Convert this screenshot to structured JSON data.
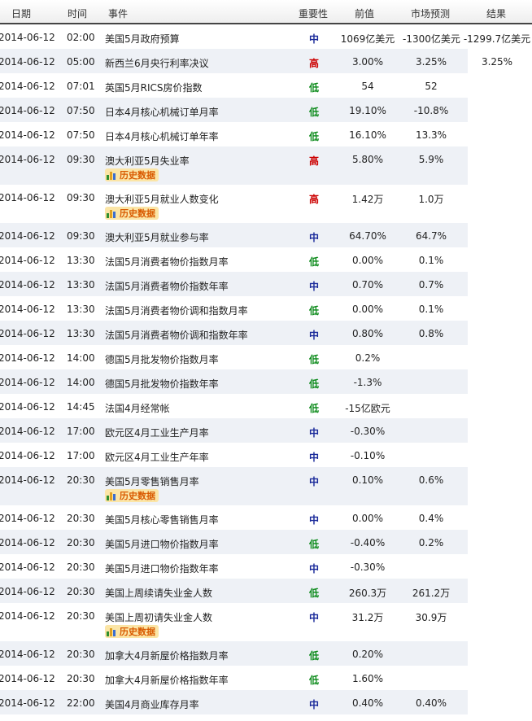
{
  "header": {
    "date": "日期",
    "time": "时间",
    "event": "事件",
    "importance": "重要性",
    "previous": "前值",
    "forecast": "市场预测",
    "result": "结果"
  },
  "history_label": "历史数据",
  "rows": [
    {
      "date": "2014-06-12",
      "time": "02:00",
      "event": "美国5月政府预算",
      "imp": "中",
      "prev": "1069亿美元",
      "fore": "-1300亿美元",
      "res": "-1299.7亿美元",
      "hist": false
    },
    {
      "date": "2014-06-12",
      "time": "05:00",
      "event": "新西兰6月央行利率决议",
      "imp": "高",
      "prev": "3.00%",
      "fore": "3.25%",
      "res": "3.25%",
      "hist": false
    },
    {
      "date": "2014-06-12",
      "time": "07:01",
      "event": "英国5月RICS房价指数",
      "imp": "低",
      "prev": "54",
      "fore": "52",
      "res": "",
      "hist": false
    },
    {
      "date": "2014-06-12",
      "time": "07:50",
      "event": "日本4月核心机械订单月率",
      "imp": "低",
      "prev": "19.10%",
      "fore": "-10.8%",
      "res": "",
      "hist": false
    },
    {
      "date": "2014-06-12",
      "time": "07:50",
      "event": "日本4月核心机械订单年率",
      "imp": "低",
      "prev": "16.10%",
      "fore": "13.3%",
      "res": "",
      "hist": false
    },
    {
      "date": "2014-06-12",
      "time": "09:30",
      "event": "澳大利亚5月失业率",
      "imp": "高",
      "prev": "5.80%",
      "fore": "5.9%",
      "res": "",
      "hist": true
    },
    {
      "date": "2014-06-12",
      "time": "09:30",
      "event": "澳大利亚5月就业人数变化",
      "imp": "高",
      "prev": "1.42万",
      "fore": "1.0万",
      "res": "",
      "hist": true
    },
    {
      "date": "2014-06-12",
      "time": "09:30",
      "event": "澳大利亚5月就业参与率",
      "imp": "中",
      "prev": "64.70%",
      "fore": "64.7%",
      "res": "",
      "hist": false
    },
    {
      "date": "2014-06-12",
      "time": "13:30",
      "event": "法国5月消费者物价指数月率",
      "imp": "低",
      "prev": "0.00%",
      "fore": "0.1%",
      "res": "",
      "hist": false
    },
    {
      "date": "2014-06-12",
      "time": "13:30",
      "event": "法国5月消费者物价指数年率",
      "imp": "中",
      "prev": "0.70%",
      "fore": "0.7%",
      "res": "",
      "hist": false
    },
    {
      "date": "2014-06-12",
      "time": "13:30",
      "event": "法国5月消费者物价调和指数月率",
      "imp": "低",
      "prev": "0.00%",
      "fore": "0.1%",
      "res": "",
      "hist": false
    },
    {
      "date": "2014-06-12",
      "time": "13:30",
      "event": "法国5月消费者物价调和指数年率",
      "imp": "中",
      "prev": "0.80%",
      "fore": "0.8%",
      "res": "",
      "hist": false
    },
    {
      "date": "2014-06-12",
      "time": "14:00",
      "event": "德国5月批发物价指数月率",
      "imp": "低",
      "prev": "0.2%",
      "fore": "",
      "res": "",
      "hist": false
    },
    {
      "date": "2014-06-12",
      "time": "14:00",
      "event": "德国5月批发物价指数年率",
      "imp": "低",
      "prev": "-1.3%",
      "fore": "",
      "res": "",
      "hist": false
    },
    {
      "date": "2014-06-12",
      "time": "14:45",
      "event": "法国4月经常帐",
      "imp": "低",
      "prev": "-15亿欧元",
      "fore": "",
      "res": "",
      "hist": false
    },
    {
      "date": "2014-06-12",
      "time": "17:00",
      "event": "欧元区4月工业生产月率",
      "imp": "中",
      "prev": "-0.30%",
      "fore": "",
      "res": "",
      "hist": false
    },
    {
      "date": "2014-06-12",
      "time": "17:00",
      "event": "欧元区4月工业生产年率",
      "imp": "中",
      "prev": "-0.10%",
      "fore": "",
      "res": "",
      "hist": false
    },
    {
      "date": "2014-06-12",
      "time": "20:30",
      "event": "美国5月零售销售月率",
      "imp": "中",
      "prev": "0.10%",
      "fore": "0.6%",
      "res": "",
      "hist": true
    },
    {
      "date": "2014-06-12",
      "time": "20:30",
      "event": "美国5月核心零售销售月率",
      "imp": "中",
      "prev": "0.00%",
      "fore": "0.4%",
      "res": "",
      "hist": false
    },
    {
      "date": "2014-06-12",
      "time": "20:30",
      "event": "美国5月进口物价指数月率",
      "imp": "低",
      "prev": "-0.40%",
      "fore": "0.2%",
      "res": "",
      "hist": false
    },
    {
      "date": "2014-06-12",
      "time": "20:30",
      "event": "美国5月进口物价指数年率",
      "imp": "中",
      "prev": "-0.30%",
      "fore": "",
      "res": "",
      "hist": false
    },
    {
      "date": "2014-06-12",
      "time": "20:30",
      "event": "美国上周续请失业金人数",
      "imp": "低",
      "prev": "260.3万",
      "fore": "261.2万",
      "res": "",
      "hist": false
    },
    {
      "date": "2014-06-12",
      "time": "20:30",
      "event": "美国上周初请失业金人数",
      "imp": "中",
      "prev": "31.2万",
      "fore": "30.9万",
      "res": "",
      "hist": true
    },
    {
      "date": "2014-06-12",
      "time": "20:30",
      "event": "加拿大4月新屋价格指数月率",
      "imp": "低",
      "prev": "0.20%",
      "fore": "",
      "res": "",
      "hist": false
    },
    {
      "date": "2014-06-12",
      "time": "20:30",
      "event": "加拿大4月新屋价格指数年率",
      "imp": "低",
      "prev": "1.60%",
      "fore": "",
      "res": "",
      "hist": false
    },
    {
      "date": "2014-06-12",
      "time": "22:00",
      "event": "美国4月商业库存月率",
      "imp": "中",
      "prev": "0.40%",
      "fore": "0.40%",
      "res": "",
      "hist": false
    }
  ],
  "importance_colors": {
    "高": "#cc0000",
    "中": "#1a2a9a",
    "低": "#0b8a1a"
  }
}
